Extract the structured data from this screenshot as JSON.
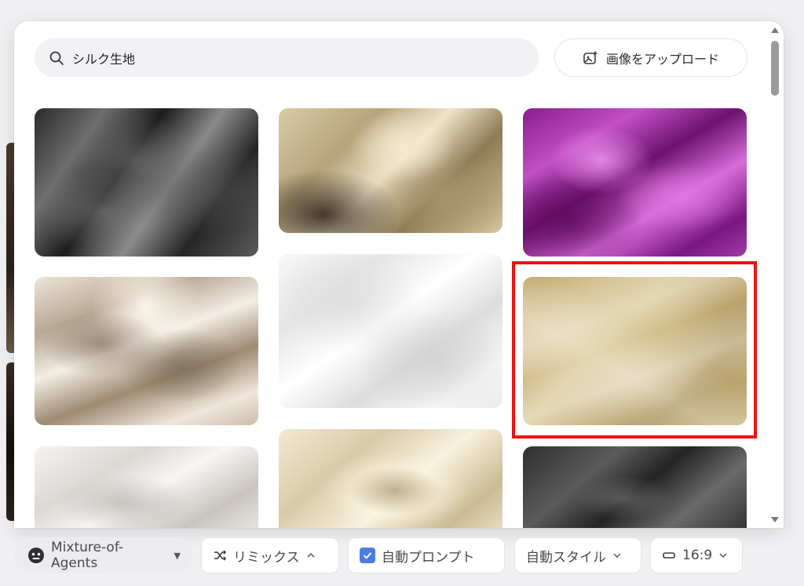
{
  "search": {
    "value": "シルク生地",
    "upload_label": "画像をアップロード"
  },
  "toolbar": {
    "model_label": "Mixture-of-Agents",
    "remix_label": "リミックス",
    "auto_prompt_label": "自動プロンプト",
    "auto_prompt_checked": true,
    "auto_style_label": "自動スタイル",
    "ratio_label": "16:9"
  },
  "colors": {
    "highlight": "#ee1111",
    "accent": "#4a7fe0"
  }
}
